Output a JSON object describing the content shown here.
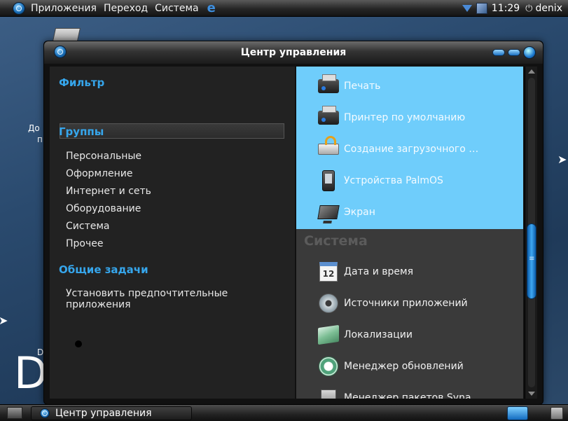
{
  "top_panel": {
    "menus": [
      "Приложения",
      "Переход",
      "Система"
    ],
    "clock": "11:29",
    "user": "denix"
  },
  "desktop": {
    "label_top_a": "До",
    "label_top_b": "п",
    "label_bottom": "D",
    "big_letter": "D"
  },
  "window": {
    "title": "Центр управления"
  },
  "left": {
    "filter_title": "Фильтр",
    "filter_value": "",
    "groups_title": "Группы",
    "groups": [
      "Персональные",
      "Оформление",
      "Интернет и сеть",
      "Оборудование",
      "Система",
      "Прочее"
    ],
    "tasks_title": "Общие задачи",
    "tasks": [
      "Установить предпочтительные приложения"
    ]
  },
  "right": {
    "hardware_items": [
      {
        "label": "Печать",
        "icon": "printer-icon"
      },
      {
        "label": "Принтер по умолчанию",
        "icon": "printer-icon"
      },
      {
        "label": "Создание загрузочного …",
        "icon": "usb-startup-disk-icon"
      },
      {
        "label": "Устройства PalmOS",
        "icon": "palm-device-icon"
      },
      {
        "label": "Экран",
        "icon": "monitor-icon"
      }
    ],
    "system_title": "Система",
    "system_items": [
      {
        "label": "Дата и время",
        "icon": "calendar-icon",
        "badge": "12"
      },
      {
        "label": "Источники приложений",
        "icon": "software-sources-icon"
      },
      {
        "label": "Локализации",
        "icon": "locale-icon"
      },
      {
        "label": "Менеджер обновлений",
        "icon": "update-manager-icon"
      },
      {
        "label": "Менеджер пакетов Syna",
        "icon": "package-manager-icon"
      }
    ],
    "scroll_position": 0.55
  },
  "bottom_panel": {
    "task_label": "Центр управления"
  },
  "colors": {
    "accent_blue": "#36a6ec",
    "highlight": "#6fcdfb",
    "pane_dark": "#222222",
    "pane_grey": "#3a3a3a"
  }
}
